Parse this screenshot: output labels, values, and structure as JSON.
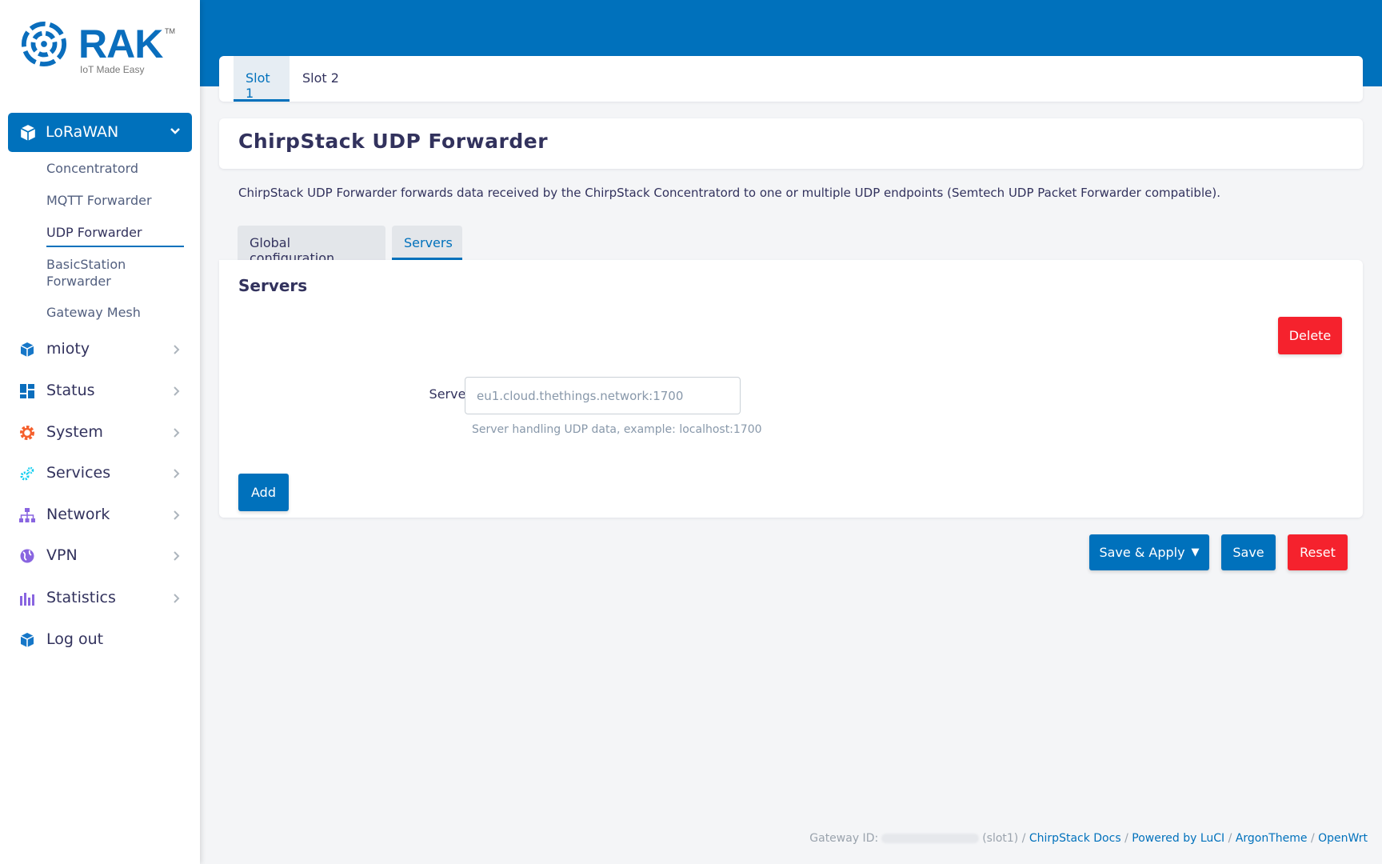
{
  "brand": {
    "name": "RAK",
    "tm": "TM",
    "tagline": "IoT Made Easy"
  },
  "sidebar": {
    "active": {
      "label": "LoRaWAN",
      "icon": "cube-icon"
    },
    "subitems": [
      {
        "label": "Concentratord"
      },
      {
        "label": "MQTT Forwarder"
      },
      {
        "label": "UDP Forwarder",
        "active": true
      },
      {
        "label": "BasicStation\nForwarder"
      },
      {
        "label": "Gateway Mesh"
      }
    ],
    "items": [
      {
        "label": "mioty",
        "icon": "cube-icon"
      },
      {
        "label": "Status",
        "icon": "dashboard-icon"
      },
      {
        "label": "System",
        "icon": "gear-icon"
      },
      {
        "label": "Services",
        "icon": "cogs-icon"
      },
      {
        "label": "Network",
        "icon": "sitemap-icon"
      },
      {
        "label": "VPN",
        "icon": "globe-icon"
      },
      {
        "label": "Statistics",
        "icon": "bar-chart-icon"
      },
      {
        "label": "Log out",
        "icon": "cube-icon"
      }
    ]
  },
  "slots": {
    "tabs": [
      "Slot 1",
      "Slot 2"
    ],
    "active": "Slot 1"
  },
  "page": {
    "title": "ChirpStack UDP Forwarder",
    "description": "ChirpStack UDP Forwarder forwards data received by the ChirpStack Concentratord to one or multiple UDP endpoints (Semtech UDP Packet Forwarder compatible).",
    "tabs": [
      "Global configuration",
      "Servers"
    ],
    "active_tab": "Servers"
  },
  "servers": {
    "section_title": "Servers",
    "delete_label": "Delete",
    "server_label": "Server",
    "server_placeholder": "eu1.cloud.thethings.network:1700",
    "server_value": "",
    "server_help": "Server handling UDP data, example: localhost:1700",
    "add_label": "Add"
  },
  "actions": {
    "save_apply": "Save & Apply",
    "save_apply_caret": "▼",
    "save": "Save",
    "reset": "Reset"
  },
  "footer": {
    "gateway_prefix": "Gateway ID:",
    "slot_suffix": "(slot1) /",
    "links": [
      "ChirpStack Docs",
      "Powered by LuCI",
      "ArgonTheme",
      "OpenWrt"
    ],
    "separator": "/"
  },
  "colors": {
    "primary": "#0071bc",
    "danger": "#f5222d",
    "text": "#32325d"
  }
}
